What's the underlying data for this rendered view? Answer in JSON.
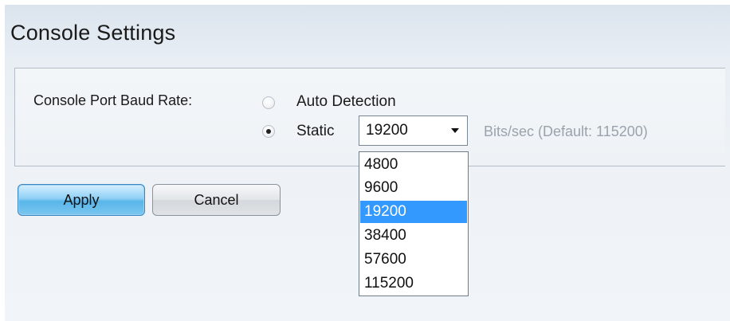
{
  "title": "Console Settings",
  "baud": {
    "label": "Console Port Baud Rate:",
    "auto_label": "Auto Detection",
    "static_label": "Static",
    "mode_selected": "Static",
    "selected_value": "19200",
    "unit_hint": "Bits/sec (Default: 115200)",
    "options": [
      "4800",
      "9600",
      "19200",
      "38400",
      "57600",
      "115200"
    ]
  },
  "buttons": {
    "apply": "Apply",
    "cancel": "Cancel"
  },
  "colors": {
    "highlight": "#3399ff",
    "apply_button": "#58b5e8"
  }
}
